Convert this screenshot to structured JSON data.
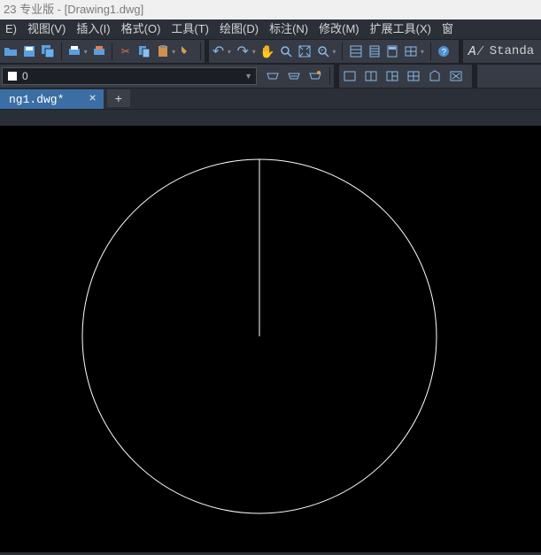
{
  "title": "23 专业版 - [Drawing1.dwg]",
  "menus": {
    "edit": "E)",
    "view": "视图(V)",
    "insert": "插入(I)",
    "format": "格式(O)",
    "tools": "工具(T)",
    "draw": "绘图(D)",
    "dimension": "标注(N)",
    "modify": "修改(M)",
    "ext_tools": "扩展工具(X)",
    "window": "窗"
  },
  "layer": {
    "name": "0"
  },
  "style": {
    "name": "Standa"
  },
  "tab": {
    "label": "ng1.dwg*",
    "close": "×",
    "new": "+"
  },
  "icons": {
    "open": "open",
    "save": "save",
    "saveall": "saveall",
    "print": "print",
    "print2": "print2",
    "cut": "✂",
    "copy": "⧉",
    "paste": "paste",
    "match": "match",
    "undo": "↶",
    "redo": "↷",
    "pan": "✋",
    "zoomwin": "⊡",
    "zoomext": "⤢",
    "zoomrt": "🔍",
    "sheet": "▦",
    "table1": "▤",
    "table2": "▥",
    "table3": "▦",
    "help": "?",
    "layers1": "⧈",
    "layers2": "⧈",
    "layers3": "⧈",
    "p1": "▭",
    "p2": "▭",
    "p3": "▭",
    "p4": "▭",
    "p5": "▭",
    "p6": "▭"
  }
}
